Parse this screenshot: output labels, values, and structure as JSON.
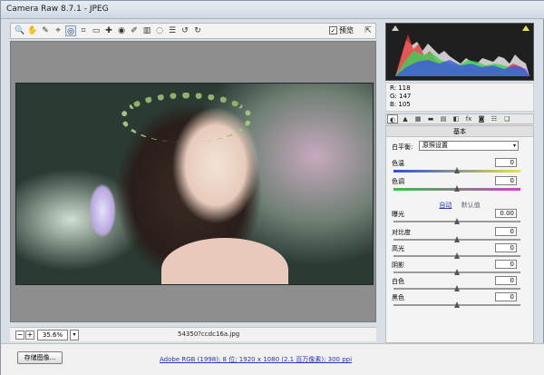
{
  "window": {
    "title": "Camera Raw 8.7.1 -  JPEG"
  },
  "toolbar": {
    "tools": [
      {
        "name": "zoom-tool-icon",
        "glyph": "🔍"
      },
      {
        "name": "hand-tool-icon",
        "glyph": "✋"
      },
      {
        "name": "white-balance-tool-icon",
        "glyph": "✎"
      },
      {
        "name": "color-sampler-tool-icon",
        "glyph": "⌖"
      },
      {
        "name": "targeted-adjustment-tool-icon",
        "glyph": "◎"
      },
      {
        "name": "crop-tool-icon",
        "glyph": "⌗"
      },
      {
        "name": "straighten-tool-icon",
        "glyph": "▭"
      },
      {
        "name": "spot-removal-tool-icon",
        "glyph": "✚"
      },
      {
        "name": "red-eye-tool-icon",
        "glyph": "◉"
      },
      {
        "name": "adjustment-brush-icon",
        "glyph": "✐"
      },
      {
        "name": "graduated-filter-icon",
        "glyph": "▥"
      },
      {
        "name": "radial-filter-icon",
        "glyph": "◌"
      },
      {
        "name": "preferences-icon",
        "glyph": "☰"
      },
      {
        "name": "rotate-left-icon",
        "glyph": "↺"
      },
      {
        "name": "rotate-right-icon",
        "glyph": "↻"
      }
    ],
    "preview_label": "预览",
    "preview_checked": "✓",
    "fullscreen_glyph": "⇱"
  },
  "status": {
    "zoom_minus": "−",
    "zoom_plus": "+",
    "zoom_value": "35.6%",
    "zoom_dropdown": "▾",
    "filename": "54350?ccdc16a.jpg"
  },
  "bottom": {
    "save_label": "存储图像...",
    "workflow_link": "Adobe RGB (1998); 8 位; 1920 x 1080 (2.1 百万像素); 300 ppi"
  },
  "readout": {
    "r": "R:  118",
    "g": "G:  147",
    "b": "B:  105"
  },
  "tabs": [
    "◐",
    "▲",
    "▦",
    "▬",
    "▤",
    "◧",
    "fx",
    "◙",
    "☷",
    "❏"
  ],
  "basic": {
    "title": "基本",
    "wb_label": "白平衡:",
    "wb_value": "原照设置",
    "wb_arrow": "▾",
    "auto_label": "自动",
    "default_label": "默认值",
    "sliders": [
      {
        "key": "temp",
        "label": "色温",
        "value": "0",
        "pos": 0.5
      },
      {
        "key": "tint",
        "label": "色调",
        "value": "0",
        "pos": 0.5
      },
      {
        "key": "exposure",
        "label": "曝光",
        "value": "0.00",
        "pos": 0.5
      },
      {
        "key": "contrast",
        "label": "对比度",
        "value": "0",
        "pos": 0.5
      },
      {
        "key": "highlights",
        "label": "高光",
        "value": "0",
        "pos": 0.5
      },
      {
        "key": "shadows",
        "label": "阴影",
        "value": "0",
        "pos": 0.5
      },
      {
        "key": "whites",
        "label": "白色",
        "value": "0",
        "pos": 0.5
      },
      {
        "key": "blacks",
        "label": "黑色",
        "value": "0",
        "pos": 0.5
      }
    ]
  },
  "colors": {
    "accent_link": "#2a35a7",
    "histogram_bg": "#1f1f1f"
  }
}
